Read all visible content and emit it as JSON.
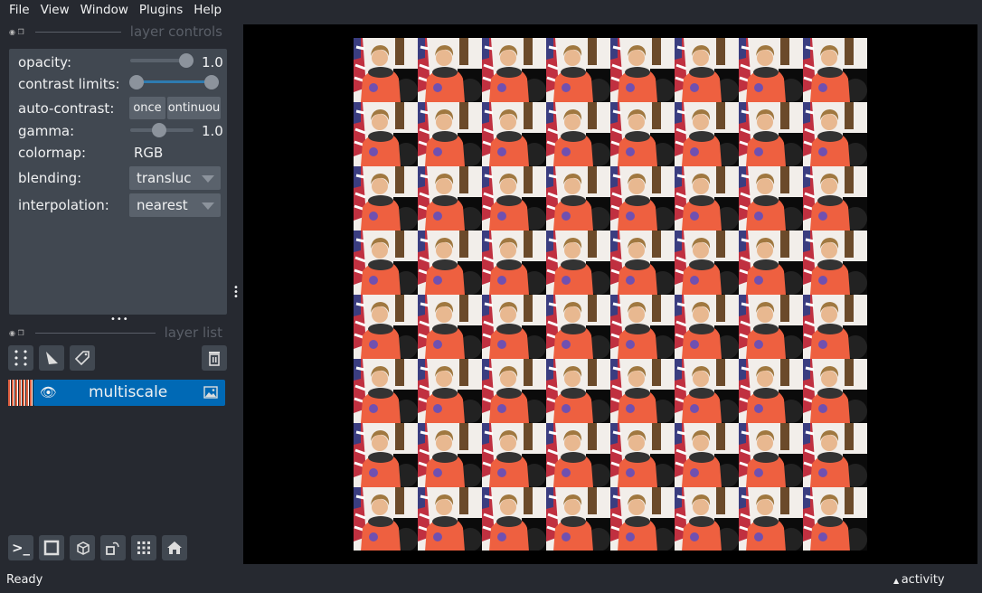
{
  "menu": [
    "File",
    "View",
    "Window",
    "Plugins",
    "Help"
  ],
  "layer_controls": {
    "title": "layer controls",
    "opacity_label": "opacity:",
    "opacity_value": "1.0",
    "opacity": 1.0,
    "contrast_label": "contrast limits:",
    "autocontrast_label": "auto-contrast:",
    "once": "once",
    "continuous": "ontinuou",
    "gamma_label": "gamma:",
    "gamma_value": "1.0",
    "colormap_label": "colormap:",
    "colormap_value": "RGB",
    "blending_label": "blending:",
    "blending_value": "transluc",
    "interp_label": "interpolation:",
    "interp_value": "nearest"
  },
  "layer_list": {
    "title": "layer list",
    "layers": [
      {
        "name": "multiscale",
        "visible": true,
        "type": "image"
      }
    ]
  },
  "status": {
    "left": "Ready",
    "right": "activity"
  },
  "colors": {
    "selected_layer": "#0069b5",
    "background": "#262930",
    "panel": "#414851"
  }
}
